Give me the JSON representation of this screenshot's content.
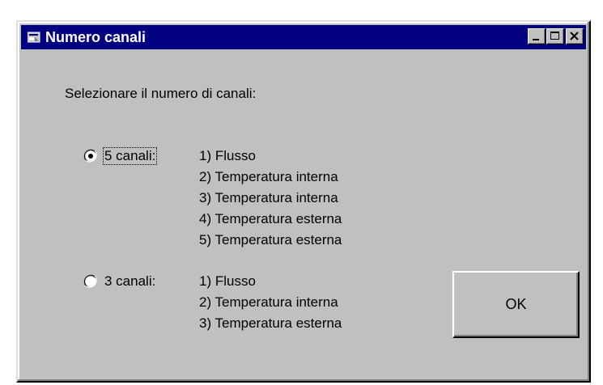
{
  "window": {
    "title": "Numero canali",
    "icon": "app-window-icon",
    "controls": {
      "minimize_icon": "minimize-icon",
      "maximize_icon": "maximize-icon",
      "close_icon": "close-icon"
    },
    "colors": {
      "face": "#c0c0c0",
      "titlebar": "#000080",
      "titletext": "#ffffff"
    }
  },
  "prompt": "Selezionare il numero di canali:",
  "options": [
    {
      "label": "5 canali:",
      "selected": true,
      "channels": [
        "1) Flusso",
        "2) Temperatura interna",
        "3) Temperatura interna",
        "4) Temperatura esterna",
        "5) Temperatura esterna"
      ]
    },
    {
      "label": "3 canali:",
      "selected": false,
      "channels": [
        "1) Flusso",
        "2) Temperatura interna",
        "3) Temperatura esterna"
      ]
    }
  ],
  "ok_label": "OK"
}
